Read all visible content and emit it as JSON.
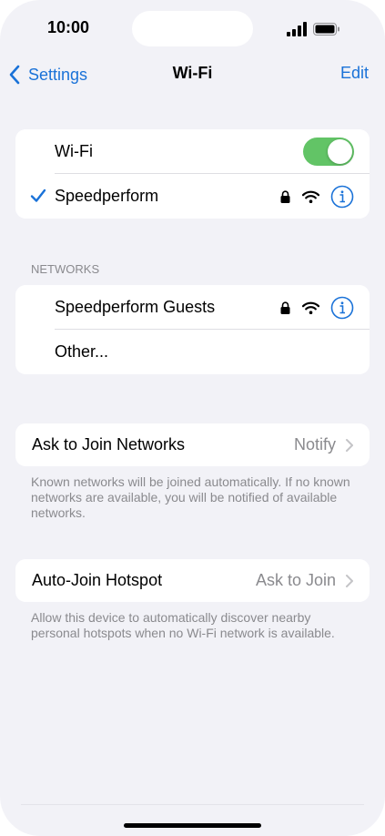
{
  "status_bar": {
    "time": "10:00"
  },
  "nav": {
    "back_label": "Settings",
    "title": "Wi-Fi",
    "edit_label": "Edit"
  },
  "wifi_group": {
    "wifi_label": "Wi-Fi",
    "wifi_on": true,
    "connected_network": "Speedperform"
  },
  "networks": {
    "header": "NETWORKS",
    "items": [
      {
        "name": "Speedperform Guests",
        "secured": true
      },
      {
        "name": "Other..."
      }
    ]
  },
  "ask_to_join": {
    "label": "Ask to Join Networks",
    "value": "Notify",
    "footnote": "Known networks will be joined automatically. If no known networks are available, you will be notified of available networks."
  },
  "auto_join": {
    "label": "Auto-Join Hotspot",
    "value": "Ask to Join",
    "footnote": "Allow this device to automatically discover nearby personal hotspots when no Wi-Fi network is available."
  },
  "colors": {
    "accent": "#1a72d8",
    "toggle_on": "#62c466",
    "background": "#f2f2f7"
  }
}
